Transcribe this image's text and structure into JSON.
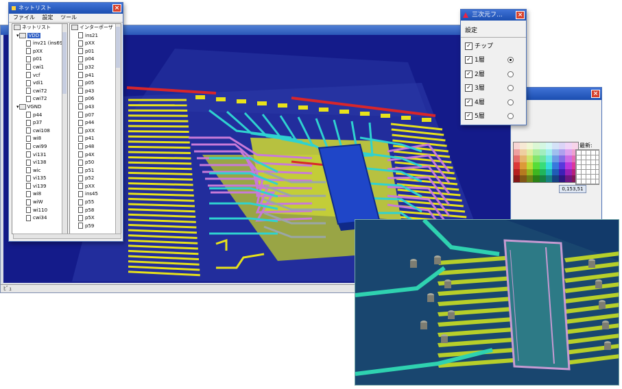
{
  "viewer": {
    "status_text": "ﾋﾞｭ"
  },
  "netlist": {
    "title": "ネットリスト",
    "menu": [
      "ファイル",
      "設定",
      "ツール"
    ],
    "left_root": "ネットリスト",
    "left_group1": "VDD",
    "left_group1_items": [
      "inv21 (ins69",
      "pXX",
      "p01",
      "cwi1",
      "vcf",
      "vdi1",
      "cwi72",
      "cwi72"
    ],
    "left_group2": "VGND",
    "left_group2_items": [
      "p44",
      "p37",
      "cwi108",
      "wi8",
      "cwi99",
      "vi131",
      "vi138",
      "wic",
      "vi135",
      "vi139",
      "wi8",
      "wiW",
      "wi110",
      "cwi34"
    ],
    "right_root": "インターポーザ",
    "right_items": [
      "ins21",
      "pXX",
      "p01",
      "p04",
      "p32",
      "p41",
      "p05",
      "p43",
      "p06",
      "p43",
      "p07",
      "p44",
      "pXX",
      "p41",
      "p48",
      "p4X",
      "p50",
      "p51",
      "p52",
      "pXX",
      "ins45",
      "p55",
      "p58",
      "p5X",
      "p59"
    ]
  },
  "layers": {
    "title": "三次元フ...",
    "menu_label": "設定",
    "chip_label": "チップ",
    "items": [
      {
        "label": "1層",
        "checked": true,
        "selected": true
      },
      {
        "label": "2層",
        "checked": true,
        "selected": false
      },
      {
        "label": "3層",
        "checked": true,
        "selected": false
      },
      {
        "label": "4層",
        "checked": true,
        "selected": false
      },
      {
        "label": "5層",
        "checked": true,
        "selected": false
      }
    ]
  },
  "palette": {
    "recent_label": "最新:",
    "rgb_value": "0,153,51"
  },
  "colors": {
    "canvas": "#141b8a",
    "trace_yellow": "#e8e21a",
    "trace_cyan": "#2fd2d0",
    "trace_pink": "#c87ad8",
    "trace_red": "#d8262a",
    "chip_blue": "#1f46c8"
  }
}
